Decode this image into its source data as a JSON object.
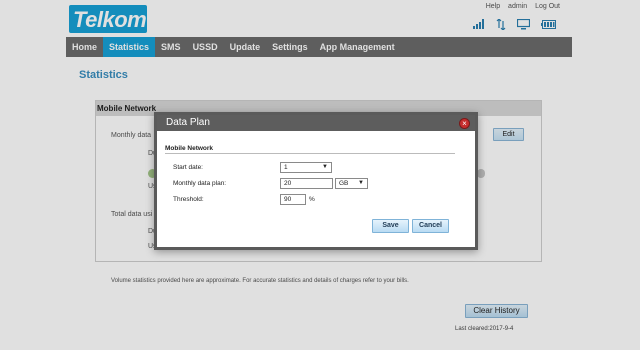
{
  "brand": {
    "logo_text": "Telkom"
  },
  "top_links": {
    "help": "Help",
    "user": "admin",
    "logout": "Log Out"
  },
  "nav": {
    "items": [
      {
        "label": "Home"
      },
      {
        "label": "Statistics"
      },
      {
        "label": "SMS"
      },
      {
        "label": "USSD"
      },
      {
        "label": "Update"
      },
      {
        "label": "Settings"
      },
      {
        "label": "App Management"
      }
    ],
    "active": "Statistics"
  },
  "page": {
    "title": "Statistics",
    "section_title": "Mobile Network",
    "monthly_label": "Monthly data",
    "du_label_1": "Du",
    "us_label_1": "Us",
    "total_label": "Total data usi",
    "du_label_2": "Du",
    "us_label_2": "Us",
    "edit_button": "Edit",
    "note": "Volume statistics provided here are approximate. For accurate statistics and details of charges refer to your bills.",
    "clear_button": "Clear History",
    "last_cleared": "Last cleared:2017-9-4"
  },
  "dialog": {
    "title": "Data Plan",
    "section": "Mobile Network",
    "start_date_label": "Start date:",
    "start_date_value": "1",
    "monthly_plan_label": "Monthly data plan:",
    "monthly_plan_value": "20",
    "monthly_plan_unit": "GB",
    "threshold_label": "Threshold:",
    "threshold_value": "90",
    "threshold_unit": "%",
    "save_button": "Save",
    "cancel_button": "Cancel"
  },
  "colors": {
    "accent": "#17a1d6",
    "nav_bg": "#6b6b6b",
    "title_blue": "#3a8fc0"
  }
}
